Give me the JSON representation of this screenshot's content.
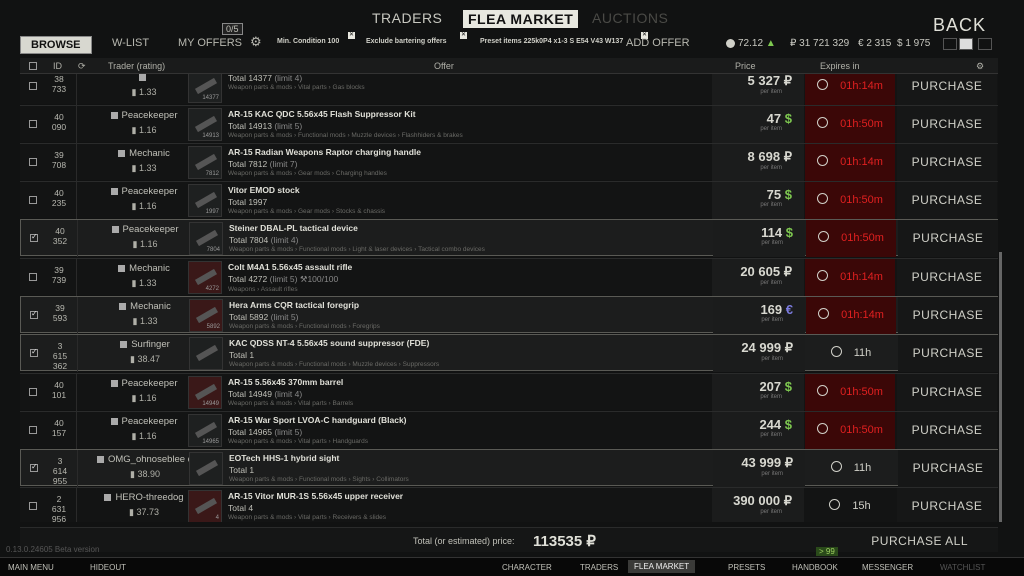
{
  "nav": {
    "traders": "TRADERS",
    "flea": "FLEA MARKET",
    "auctions": "AUCTIONS",
    "back": "BACK"
  },
  "subnav": {
    "browse": "BROWSE",
    "wlist": "W-LIST",
    "my_offers": "MY OFFERS",
    "offers_count": "0/5",
    "add_offer": "ADD OFFER"
  },
  "filters": [
    "Min. Condition 100",
    "Exclude bartering offers",
    "Preset items 225k0P4 x1-3 S E54 V43 W137"
  ],
  "balance": {
    "rating": "72.12",
    "rub": "₽ 31 721 329",
    "eur": "€ 2 315",
    "usd": "$ 1 975"
  },
  "columns": {
    "id": "ID",
    "trader": "Trader (rating)",
    "offer": "Offer",
    "price": "Price",
    "expires": "Expires in"
  },
  "rows": [
    {
      "id": "38\n733",
      "trader": "",
      "rating": "1.33",
      "name": "",
      "total": "Total 14377",
      "limit": "(limit 4)",
      "cat": "Weapon parts & mods › Vital parts › Gas blocks",
      "tid": "14377",
      "price": "5 327",
      "cur": "₽",
      "curtype": "rub",
      "expires": "01h:14m",
      "red": true,
      "sel": false,
      "thumbred": false
    },
    {
      "id": "40\n090",
      "trader": "Peacekeeper",
      "rating": "1.16",
      "name": "AR-15 KAC QDC 5.56x45 Flash Suppressor Kit",
      "total": "Total 14913",
      "limit": "(limit 5)",
      "cat": "Weapon parts & mods › Functional mods › Muzzle devices › Flashhiders & brakes",
      "tid": "14913",
      "price": "47",
      "cur": "$",
      "curtype": "usd",
      "expires": "01h:50m",
      "red": true,
      "sel": false,
      "thumbred": false
    },
    {
      "id": "39\n708",
      "trader": "Mechanic",
      "rating": "1.33",
      "name": "AR-15 Radian Weapons Raptor charging handle",
      "total": "Total 7812",
      "limit": "(limit 7)",
      "cat": "Weapon parts & mods › Gear mods › Charging handles",
      "tid": "7812",
      "price": "8 698",
      "cur": "₽",
      "curtype": "rub",
      "expires": "01h:14m",
      "red": true,
      "sel": false,
      "thumbred": false
    },
    {
      "id": "40\n235",
      "trader": "Peacekeeper",
      "rating": "1.16",
      "name": "Vitor EMOD stock",
      "total": "Total 1997",
      "limit": "",
      "cat": "Weapon parts & mods › Gear mods › Stocks & chassis",
      "tid": "1997",
      "price": "75",
      "cur": "$",
      "curtype": "usd",
      "expires": "01h:50m",
      "red": true,
      "sel": false,
      "thumbred": false
    },
    {
      "id": "40\n352",
      "trader": "Peacekeeper",
      "rating": "1.16",
      "name": "Steiner DBAL-PL tactical device",
      "total": "Total 7804",
      "limit": "(limit 4)",
      "cat": "Weapon parts & mods › Functional mods › Light & laser devices › Tactical combo devices",
      "tid": "7804",
      "price": "114",
      "cur": "$",
      "curtype": "usd",
      "expires": "01h:50m",
      "red": true,
      "sel": true,
      "thumbred": false
    },
    {
      "id": "39\n739",
      "trader": "Mechanic",
      "rating": "1.33",
      "name": "Colt M4A1 5.56x45 assault rifle",
      "total": "Total 4272",
      "limit": "(limit 5) ⚒100/100",
      "cat": "Weapons › Assault rifles",
      "tid": "4272",
      "price": "20 605",
      "cur": "₽",
      "curtype": "rub",
      "expires": "01h:14m",
      "red": true,
      "sel": false,
      "thumbred": true
    },
    {
      "id": "39\n593",
      "trader": "Mechanic",
      "rating": "1.33",
      "name": "Hera Arms CQR tactical foregrip",
      "total": "Total 5892",
      "limit": "(limit 5)",
      "cat": "Weapon parts & mods › Functional mods › Foregrips",
      "tid": "5892",
      "price": "169",
      "cur": "€",
      "curtype": "eur",
      "expires": "01h:14m",
      "red": true,
      "sel": true,
      "thumbred": true
    },
    {
      "id": "3\n615\n362",
      "trader": "Surfinger",
      "rating": "38.47",
      "name": "KAC QDSS NT-4 5.56x45 sound suppressor (FDE)",
      "total": "Total 1",
      "limit": "",
      "cat": "Weapon parts & mods › Functional mods › Muzzle devices › Suppressors",
      "tid": "",
      "price": "24 999",
      "cur": "₽",
      "curtype": "rub",
      "expires": "11h",
      "red": false,
      "sel": true,
      "thumbred": false
    },
    {
      "id": "40\n101",
      "trader": "Peacekeeper",
      "rating": "1.16",
      "name": "AR-15 5.56x45 370mm barrel",
      "total": "Total 14949",
      "limit": "(limit 4)",
      "cat": "Weapon parts & mods › Vital parts › Barrels",
      "tid": "14949",
      "price": "207",
      "cur": "$",
      "curtype": "usd",
      "expires": "01h:50m",
      "red": true,
      "sel": false,
      "thumbred": true
    },
    {
      "id": "40\n157",
      "trader": "Peacekeeper",
      "rating": "1.16",
      "name": "AR-15 War Sport LVOA-C handguard (Black)",
      "total": "Total 14965",
      "limit": "(limit 5)",
      "cat": "Weapon parts & mods › Vital parts › Handguards",
      "tid": "14965",
      "price": "244",
      "cur": "$",
      "curtype": "usd",
      "expires": "01h:50m",
      "red": true,
      "sel": false,
      "thumbred": false
    },
    {
      "id": "3\n614\n955",
      "trader": "OMG_ohnoseblee d",
      "rating": "38.90",
      "name": "EOTech HHS-1 hybrid sight",
      "total": "Total 1",
      "limit": "",
      "cat": "Weapon parts & mods › Functional mods › Sights › Collimators",
      "tid": "",
      "price": "43 999",
      "cur": "₽",
      "curtype": "rub",
      "expires": "11h",
      "red": false,
      "sel": true,
      "thumbred": false
    },
    {
      "id": "2\n631\n956",
      "trader": "HERO-threedog",
      "rating": "37.73",
      "name": "AR-15 Vitor MUR-1S 5.56x45 upper receiver",
      "total": "Total 4",
      "limit": "",
      "cat": "Weapon parts & mods › Vital parts › Receivers & slides",
      "tid": "4",
      "price": "390 000",
      "cur": "₽",
      "curtype": "rub",
      "expires": "15h",
      "red": false,
      "sel": false,
      "thumbred": true
    }
  ],
  "footer": {
    "per_item": "per item",
    "purchase": "PURCHASE",
    "total_label": "Total (or estimated) price:",
    "total_value": "113535",
    "total_cur": "₽",
    "purchase_all": "PURCHASE ALL",
    "version": "0.13.0.24605 Beta version",
    "xp": "> 99"
  },
  "taskbar": [
    "MAIN MENU",
    "HIDEOUT",
    "CHARACTER",
    "TRADERS",
    "FLEA MARKET",
    "PRESETS",
    "HANDBOOK",
    "MESSENGER",
    "WATCHLIST"
  ]
}
